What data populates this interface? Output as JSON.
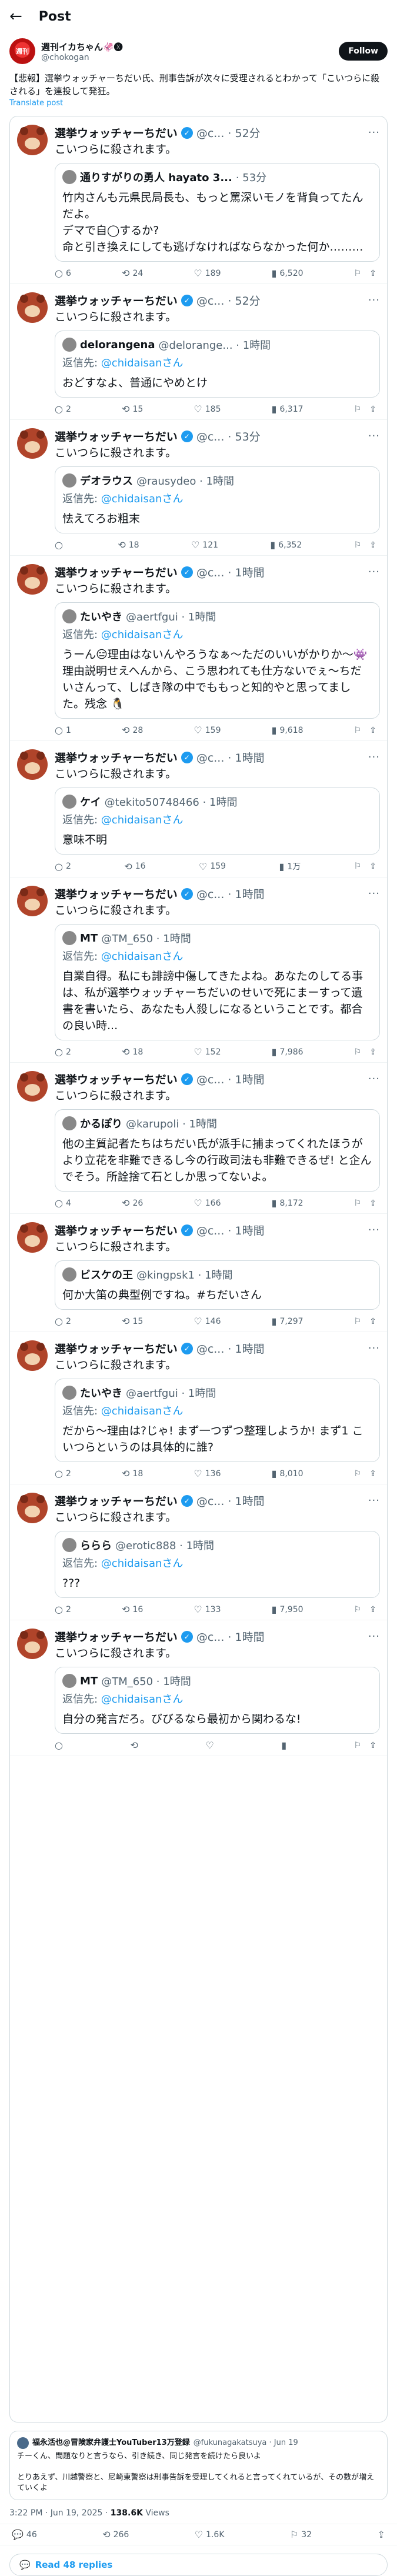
{
  "topbar": {
    "title": "Post"
  },
  "author": {
    "avatar_text": "週刊",
    "name": "週刊イカちゃん🦑🅧",
    "handle": "@chokogan",
    "follow_label": "Follow"
  },
  "post": {
    "text": "【悲報】選挙ウォッチャーちだい氏、刑事告訴が次々に受理されるとわかって「こいつらに殺される」を連投して発狂。",
    "translate": "Translate post"
  },
  "tweets": [
    {
      "name": "選挙ウォッチャーちだい",
      "meta": "@c... · 52分",
      "text": "こいつらに殺されます。",
      "quote": {
        "name": "通りすがりの勇人 hayato 3...",
        "meta": "· 53分",
        "reply_prefix": "",
        "reply_handle": "",
        "text": "竹内さんも元県民局長も、もっと罵深いモノを背負ってたんだよ。\nデマで自◯するか?\n命と引き換えにしても逃げなければならなかった何か………"
      },
      "stats": {
        "replies": "6",
        "reposts": "24",
        "likes": "189",
        "views": "6,520"
      }
    },
    {
      "name": "選挙ウォッチャーちだい",
      "meta": "@c... · 52分",
      "text": "こいつらに殺されます。",
      "quote": {
        "name": "delorangena",
        "meta": "@delorange... · 1時間",
        "reply_prefix": "返信先: ",
        "reply_handle": "@chidaisanさん",
        "text": "おどすなよ、普通にやめとけ"
      },
      "stats": {
        "replies": "2",
        "reposts": "15",
        "likes": "185",
        "views": "6,317"
      }
    },
    {
      "name": "選挙ウォッチャーちだい",
      "meta": "@c... · 53分",
      "text": "こいつらに殺されます。",
      "quote": {
        "name": "デオラウス",
        "meta": "@rausydeo · 1時間",
        "reply_prefix": "返信先: ",
        "reply_handle": "@chidaisanさん",
        "text": "怯えてろお粗末"
      },
      "stats": {
        "replies": "",
        "reposts": "18",
        "likes": "121",
        "views": "6,352"
      }
    },
    {
      "name": "選挙ウォッチャーちだい",
      "meta": "@c... · 1時間",
      "text": "こいつらに殺されます。",
      "quote": {
        "name": "たいやき",
        "meta": "@aertfgui · 1時間",
        "reply_prefix": "返信先: ",
        "reply_handle": "@chidaisanさん",
        "text": "うーん😑理由はないんやろうなぁ〜ただのいいがかりか〜👾理由説明せえへんから、こう思われても仕方ないでぇ〜ちだいさんって、しばき隊の中でももっと知的やと思ってました。残念 🐧"
      },
      "stats": {
        "replies": "1",
        "reposts": "28",
        "likes": "159",
        "views": "9,618"
      }
    },
    {
      "name": "選挙ウォッチャーちだい",
      "meta": "@c... · 1時間",
      "text": "こいつらに殺されます。",
      "quote": {
        "name": "ケイ",
        "meta": "@tekito50748466 · 1時間",
        "reply_prefix": "返信先: ",
        "reply_handle": "@chidaisanさん",
        "text": "意味不明"
      },
      "stats": {
        "replies": "2",
        "reposts": "16",
        "likes": "159",
        "views": "1万"
      }
    },
    {
      "name": "選挙ウォッチャーちだい",
      "meta": "@c... · 1時間",
      "text": "こいつらに殺されます。",
      "quote": {
        "name": "MT",
        "meta": "@TM_650 · 1時間",
        "reply_prefix": "返信先: ",
        "reply_handle": "@chidaisanさん",
        "text": "自業自得。私にも誹謗中傷してきたよね。あなたのしてる事は、私が選挙ウォッチャーちだいのせいで死にまーすって遺書を書いたら、あなたも人殺しになるということです。都合の良い時..."
      },
      "stats": {
        "replies": "2",
        "reposts": "18",
        "likes": "152",
        "views": "7,986"
      }
    },
    {
      "name": "選挙ウォッチャーちだい",
      "meta": "@c... · 1時間",
      "text": "こいつらに殺されます。",
      "quote": {
        "name": "かるぽり",
        "meta": "@karupoli · 1時間",
        "reply_prefix": "",
        "reply_handle": "",
        "text": "他の主質記者たちはちだい氏が派手に捕まってくれたほうがより立花を非難できるし今の行政司法も非難できるぜ! と企んでそう。所詮捨て石としか思ってないよ。"
      },
      "stats": {
        "replies": "4",
        "reposts": "26",
        "likes": "166",
        "views": "8,172"
      }
    },
    {
      "name": "選挙ウォッチャーちだい",
      "meta": "@c... · 1時間",
      "text": "こいつらに殺されます。",
      "quote": {
        "name": "ビスケの王",
        "meta": "@kingpsk1 · 1時間",
        "reply_prefix": "",
        "reply_handle": "",
        "text": "何か大笛の典型例ですね。#ちだいさん"
      },
      "stats": {
        "replies": "2",
        "reposts": "15",
        "likes": "146",
        "views": "7,297"
      }
    },
    {
      "name": "選挙ウォッチャーちだい",
      "meta": "@c... · 1時間",
      "text": "こいつらに殺されます。",
      "quote": {
        "name": "たいやき",
        "meta": "@aertfgui · 1時間",
        "reply_prefix": "返信先: ",
        "reply_handle": "@chidaisanさん",
        "text": "だから〜理由は?じゃ! まず一つずつ整理しようか! まず1 こいつらというのは具体的に誰?"
      },
      "stats": {
        "replies": "2",
        "reposts": "18",
        "likes": "136",
        "views": "8,010"
      }
    },
    {
      "name": "選挙ウォッチャーちだい",
      "meta": "@c... · 1時間",
      "text": "こいつらに殺されます。",
      "quote": {
        "name": "ららら",
        "meta": "@erotic888 · 1時間",
        "reply_prefix": "返信先: ",
        "reply_handle": "@chidaisanさん",
        "text": "???"
      },
      "stats": {
        "replies": "2",
        "reposts": "16",
        "likes": "133",
        "views": "7,950"
      }
    },
    {
      "name": "選挙ウォッチャーちだい",
      "meta": "@c... · 1時間",
      "text": "こいつらに殺されます。",
      "quote": {
        "name": "MT",
        "meta": "@TM_650 · 1時間",
        "reply_prefix": "返信先: ",
        "reply_handle": "@chidaisanさん",
        "text": "自分の発言だろ。びびるなら最初から関わるな!"
      },
      "stats": {
        "replies": "",
        "reposts": "",
        "likes": "",
        "views": ""
      }
    }
  ],
  "footer_reply": {
    "name": "福永活也@冒険家弁護士YouTuber13万登録",
    "meta": "@fukunagakatsuya · Jun 19",
    "text": "チーくん、問題なりと言うなら、引き続き、同じ発言を続けたら良いよ\n\nとりあえず、川越警察と、尼崎東警察は刑事告訴を受理してくれると言ってくれているが、その数が増えていくよ"
  },
  "timestamp": {
    "time": "3:22 PM · Jun 19, 2025 · ",
    "views": "138.6K",
    "views_label": " Views"
  },
  "bottom_stats": {
    "replies": "46",
    "reposts": "266",
    "likes": "1.6K",
    "bookmarks": "32"
  },
  "read_replies": "Read 48 replies"
}
